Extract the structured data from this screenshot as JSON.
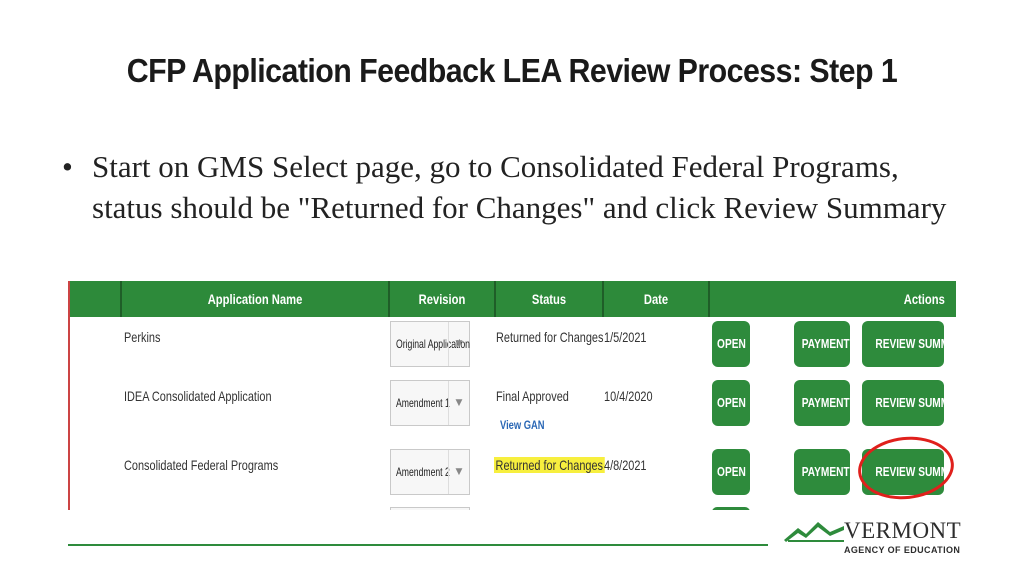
{
  "slide": {
    "title": "CFP Application Feedback LEA Review Process: Step 1",
    "bullet_symbol": "•",
    "bullet": "Start on GMS Select page, go to Consolidated Federal Programs, status should be \"Returned for Changes\" and click Review Summary"
  },
  "table": {
    "headers": {
      "application_name": "Application Name",
      "revision": "Revision",
      "status": "Status",
      "date": "Date",
      "actions": "Actions"
    },
    "rows": [
      {
        "application_name": "Perkins",
        "revision": "Original Application",
        "status": "Returned for Changes",
        "status_link": "",
        "date": "1/5/2021",
        "open": "OPEN",
        "payments": "PAYMENTS",
        "review_summary": "REVIEW SUMMARY"
      },
      {
        "application_name": "IDEA Consolidated Application",
        "revision": "Amendment 1",
        "status": "Final Approved",
        "status_link": "View GAN",
        "date": "10/4/2020",
        "open": "OPEN",
        "payments": "PAYMENTS",
        "review_summary": "REVIEW SUMMARY"
      },
      {
        "application_name": "Consolidated Federal Programs",
        "revision": "Amendment 2",
        "status": "Returned for Changes",
        "status_link": "",
        "date": "4/8/2021",
        "open": "OPEN",
        "payments": "PAYMENTS",
        "review_summary": "REVIEW SUMMARY"
      }
    ],
    "dropdown_arrow": "▼"
  },
  "logo": {
    "name": "VERMONT",
    "subtitle": "AGENCY OF EDUCATION"
  },
  "colors": {
    "header_green": "#2d8a3a",
    "button_green": "#2e8b3c",
    "highlight": "#f7ef3e",
    "annotation_red": "#e0201c"
  }
}
